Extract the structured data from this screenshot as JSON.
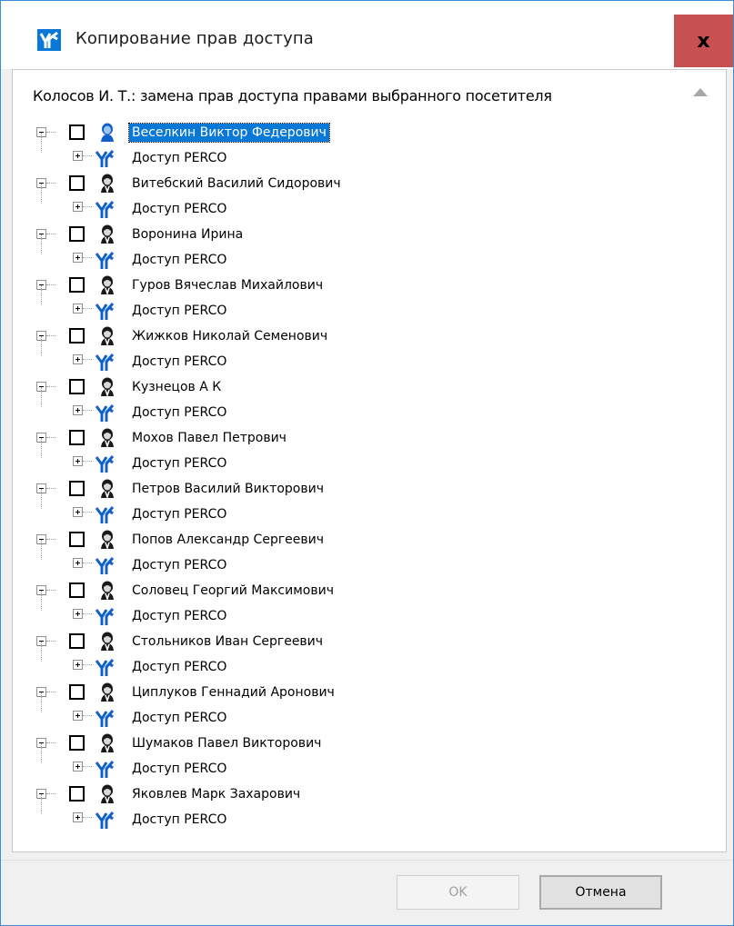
{
  "window": {
    "title": "Копирование прав доступа",
    "close_label": "x"
  },
  "header": {
    "caption": "Колосов И. Т.: замена прав доступа правами выбранного посетителя"
  },
  "tree": {
    "child_label": "Доступ PERCO",
    "selected_index": 0,
    "persons": [
      "Веселкин Виктор Федерович",
      "Витебский Василий Сидорович",
      "Воронина Ирина",
      "Гуров Вячеслав Михайлович",
      "Жижков Николай Семенович",
      "Кузнецов А К",
      "Мохов Павел Петрович",
      "Петров Василий Викторович",
      "Попов Александр Сергеевич",
      "Соловец Георгий Максимович",
      "Стольников Иван Сергеевич",
      "Циплуков Геннадий Аронович",
      "Шумаков Павел Викторович",
      "Яковлев Марк Захарович"
    ]
  },
  "buttons": {
    "ok": "OK",
    "cancel": "Отмена"
  },
  "colors": {
    "accent": "#0a78d7",
    "close_bg": "#c75050",
    "icon_blue": "#1060c8"
  },
  "icons": {
    "app": "perco-logo-icon",
    "person": "person-icon",
    "access": "perco-access-icon"
  }
}
